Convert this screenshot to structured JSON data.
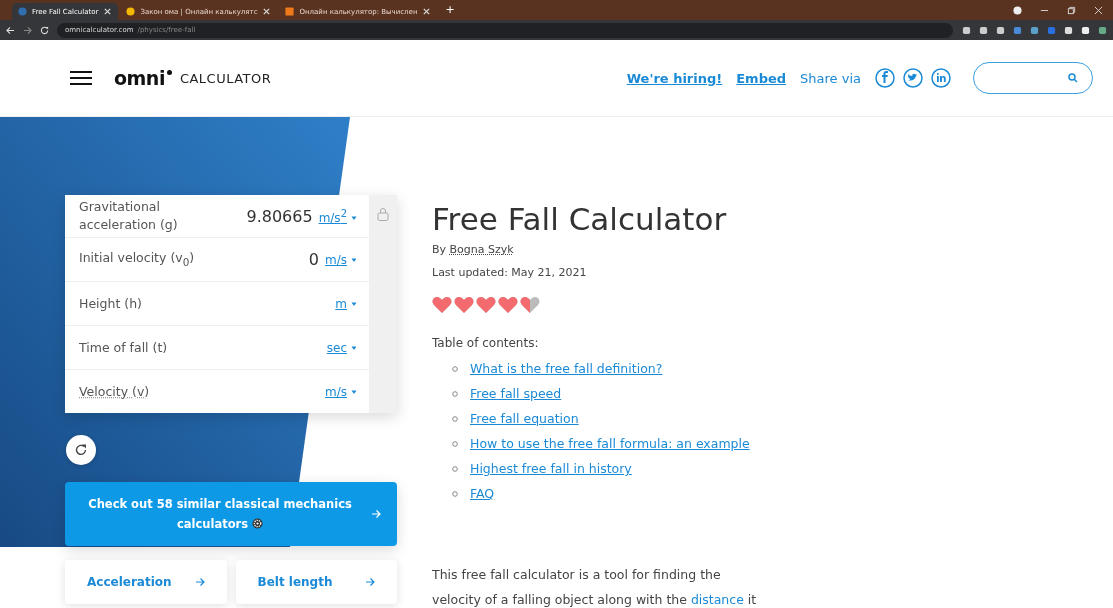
{
  "browser": {
    "tabs": [
      {
        "title": "Free Fall Calculator",
        "selected": true,
        "kind": "omni"
      },
      {
        "title": "Закон ома | Онлайн калькулятс",
        "selected": false,
        "kind": "circle"
      },
      {
        "title": "Онлайн калькулятор: Вычислен",
        "selected": false,
        "kind": "square"
      }
    ],
    "new_tab": "+",
    "url_host": "omnicalculator.com",
    "url_path": "/physics/free-fall"
  },
  "header": {
    "logo_bold": "omni",
    "logo_text": "CALCULATOR",
    "links": [
      "We're hiring!",
      "Embed"
    ],
    "share_label": "Share via"
  },
  "calculator": {
    "rows": [
      {
        "label": "Gravitational acceleration (g)",
        "value": "9.80665",
        "unit": "m/s$^{2}$",
        "tooltip": false
      },
      {
        "label": "Initial velocity (v$_{0}$)",
        "value": "0",
        "unit": "m/s",
        "tooltip": false
      },
      {
        "label": "Height (h)",
        "unit": "m",
        "tooltip": false
      },
      {
        "label": "Time of fall (t)",
        "unit": "sec",
        "tooltip": false
      },
      {
        "label": "Velocity (v)",
        "unit": "m/s",
        "tooltip": true
      }
    ],
    "similar_button": "Check out 58 similar classical mechanics calculators",
    "related": [
      "Acceleration",
      "Belt length"
    ]
  },
  "article": {
    "title": "Free Fall Calculator",
    "by": "By",
    "author": "Bogna Szyk",
    "updated": "Last updated: May 21, 2021",
    "stars": 4.5,
    "toc_label": "Table of contents:",
    "toc": [
      "What is the free fall definition?",
      "Free fall speed",
      "Free fall equation",
      "How to use the free fall formula: an example",
      "Highest free fall in history",
      "FAQ"
    ],
    "intro_before": "This free fall calculator is a tool for finding the velocity of a falling object along with the",
    "intro_link": "distance",
    "intro_after": "it"
  }
}
